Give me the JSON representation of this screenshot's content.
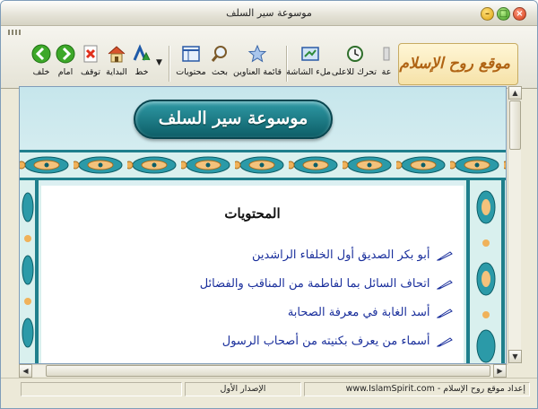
{
  "window": {
    "title": "موسوعة سير السلف"
  },
  "toolbar": {
    "buttons": [
      {
        "label": "خلف",
        "icon": "back-arrow-icon"
      },
      {
        "label": "امام",
        "icon": "forward-arrow-icon"
      },
      {
        "label": "توقف",
        "icon": "stop-icon"
      },
      {
        "label": "البداية",
        "icon": "home-icon"
      },
      {
        "label": "خط",
        "icon": "font-icon"
      },
      {
        "label": "محتويات",
        "icon": "contents-icon"
      },
      {
        "label": "بحث",
        "icon": "search-icon"
      },
      {
        "label": "قائمة العناوين",
        "icon": "favorites-star-icon"
      },
      {
        "label": "ملء الشاشة",
        "icon": "fullscreen-icon"
      },
      {
        "label": "تحرك للاعلى",
        "icon": "scroll-up-clock-icon"
      },
      {
        "label": "عة",
        "icon": "cut-off-icon"
      }
    ],
    "logo_text": "موقع روح الإسلام"
  },
  "content": {
    "banner": "موسوعة سير السلف",
    "heading": "المحتويات",
    "links": [
      "أبو بكر الصديق أول الخلفاء الراشدين",
      "اتحاف السائل بما لفاطمة من المناقب والفضائل",
      "أسد الغابة في معرفة الصحابة",
      "أسماء من يعرف بكنيته من أصحاب الرسول"
    ]
  },
  "statusbar": {
    "version": "الإصدار الأول",
    "credit": "إعداد موقع روح الإسلام - www.IslamSpirit.com"
  },
  "colors": {
    "link": "#1a2f9c",
    "banner": "#0d5e67",
    "frame": "#2a8a9a"
  }
}
